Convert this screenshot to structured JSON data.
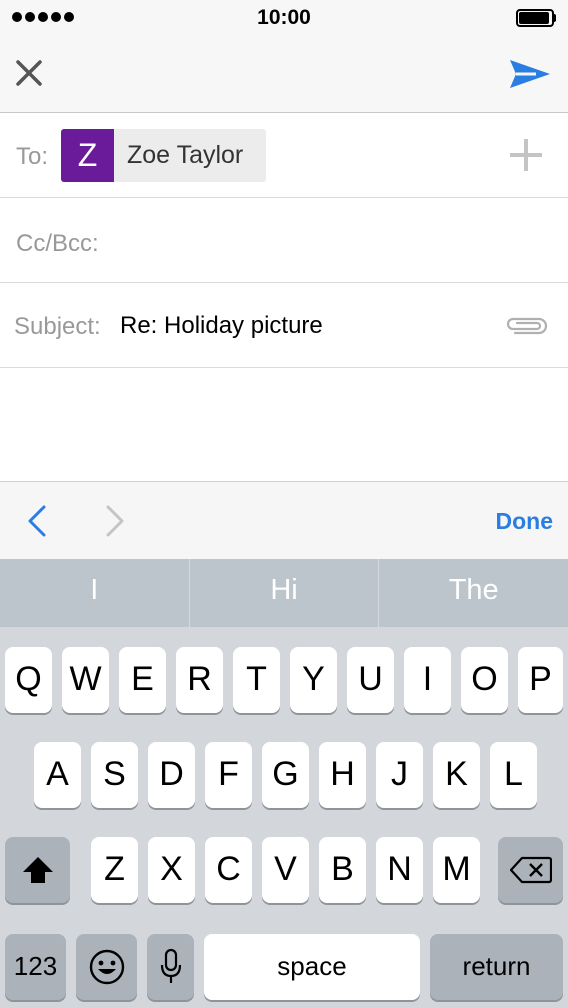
{
  "status_bar": {
    "time": "10:00"
  },
  "compose": {
    "to_label": "To:",
    "recipient": {
      "initial": "Z",
      "name": "Zoe Taylor",
      "avatar_color": "#6a1b9a"
    },
    "cc_label": "Cc/Bcc:",
    "subject_label": "Subject:",
    "subject_value": "Re: Holiday picture"
  },
  "toolbar": {
    "done_label": "Done"
  },
  "colors": {
    "accent": "#2a7de1",
    "send_icon": "#2a7de1"
  },
  "icons": {
    "close": "close-icon",
    "send": "send-icon",
    "add": "plus-icon",
    "attach": "paperclip-icon",
    "prev": "chevron-left-icon",
    "next": "chevron-right-icon"
  },
  "predictions": [
    "I",
    "Hi",
    "The"
  ],
  "keyboard": {
    "row1": [
      "Q",
      "W",
      "E",
      "R",
      "T",
      "Y",
      "U",
      "I",
      "O",
      "P"
    ],
    "row2": [
      "A",
      "S",
      "D",
      "F",
      "G",
      "H",
      "J",
      "K",
      "L"
    ],
    "row3": [
      "Z",
      "X",
      "C",
      "V",
      "B",
      "N",
      "M"
    ],
    "numbers_label": "123",
    "space_label": "space",
    "return_label": "return"
  }
}
